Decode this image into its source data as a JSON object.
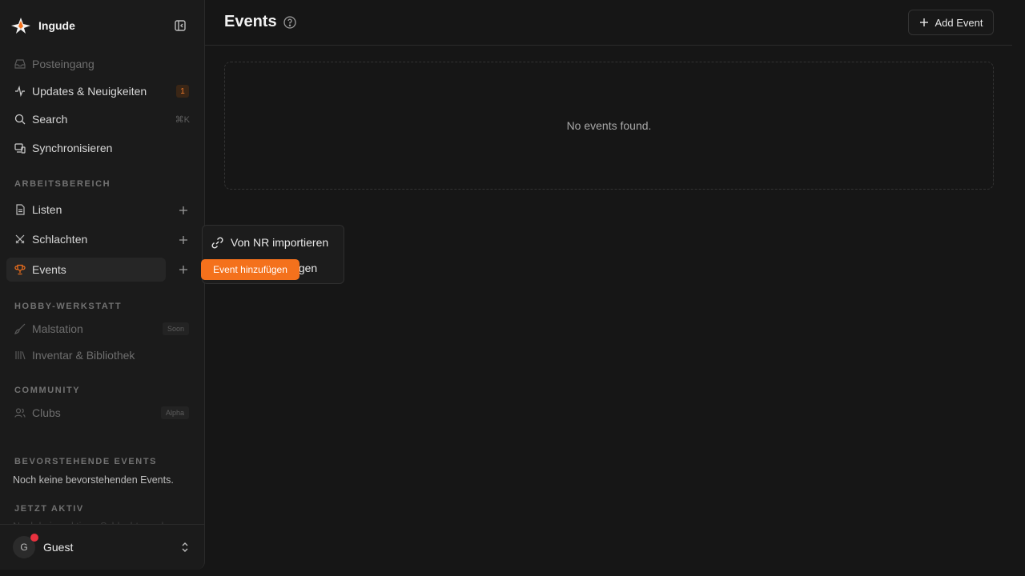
{
  "app": {
    "name": "Ingude"
  },
  "nav": {
    "inbox": "Posteingang",
    "updates": "Updates & Neuigkeiten",
    "updates_count": "1",
    "search": "Search",
    "search_shortcut": "⌘K",
    "sync": "Synchronisieren"
  },
  "workspace": {
    "label": "ARBEITSBEREICH",
    "lists": "Listen",
    "battles": "Schlachten",
    "events": "Events"
  },
  "hobby": {
    "label": "HOBBY-WERKSTATT",
    "paint_station": "Malstation",
    "paint_station_tag": "Soon",
    "inventory": "Inventar & Bibliothek"
  },
  "community": {
    "label": "COMMUNITY",
    "clubs": "Clubs",
    "clubs_tag": "Alpha"
  },
  "upcoming": {
    "label": "BEVORSTEHENDE EVENTS",
    "empty": "Noch keine bevorstehenden Events."
  },
  "active_now": {
    "label": "JETZT AKTIV",
    "text": "Noch keine aktiven Schlachten oder"
  },
  "user": {
    "initial": "G",
    "name": "Guest"
  },
  "main": {
    "title": "Events",
    "add_button": "Add Event",
    "empty_state": "No events found."
  },
  "popup": {
    "import": "Von NR importieren",
    "add": "Event hinzufügen",
    "tooltip": "Event hinzufügen"
  },
  "colors": {
    "accent": "#f4711c",
    "notification": "#e8323f",
    "background": "#161616"
  }
}
